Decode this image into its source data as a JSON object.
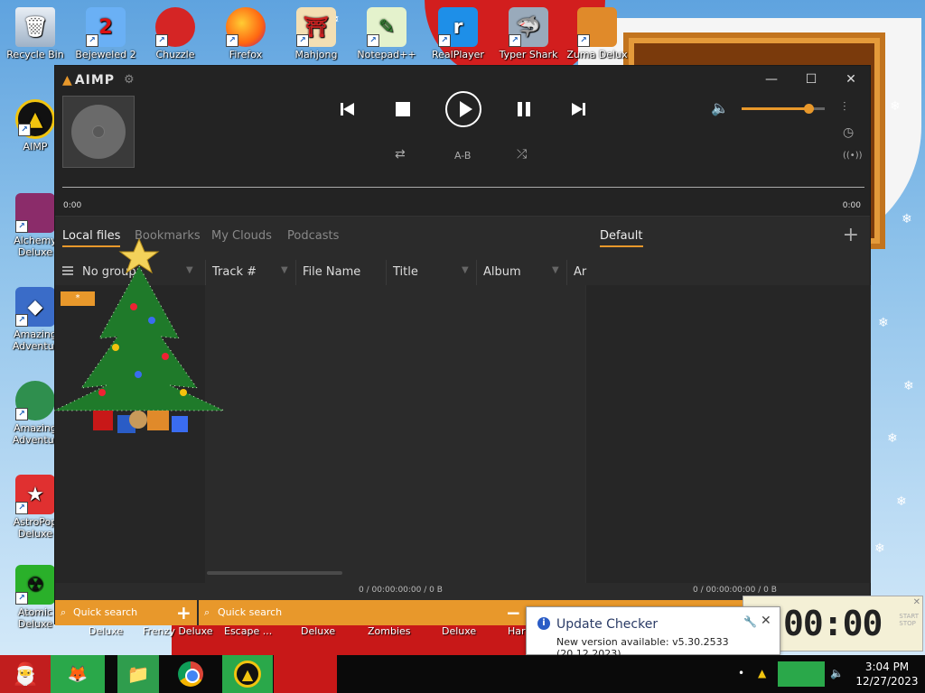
{
  "desktop": {
    "top_icons": [
      {
        "label": "Recycle Bin",
        "icon": "recycle-bin-icon"
      },
      {
        "label": "Bejeweled 2",
        "icon": "bejeweled-icon"
      },
      {
        "label": "Chuzzle",
        "icon": "chuzzle-icon"
      },
      {
        "label": "Firefox",
        "icon": "firefox-icon"
      },
      {
        "label": "Mahjong",
        "icon": "mahjong-icon"
      },
      {
        "label": "Notepad++",
        "icon": "notepadpp-icon"
      },
      {
        "label": "RealPlayer",
        "icon": "realplayer-icon"
      },
      {
        "label": "Typer Shark",
        "icon": "typer-shark-icon"
      },
      {
        "label": "Zuma Delux",
        "icon": "zuma-icon"
      }
    ],
    "left_icons": [
      {
        "label": "AIMP",
        "icon": "aimp-icon"
      },
      {
        "label": "Alchemy Deluxe",
        "icon": "alchemy-icon"
      },
      {
        "label": "Amazing Adventur",
        "icon": "amazing-adventures-icon"
      },
      {
        "label": "Amazing Adventur",
        "icon": "amazing-adventures-2-icon"
      },
      {
        "label": "AstroPop Deluxe",
        "icon": "astropop-icon"
      },
      {
        "label": "Atomic Deluxe",
        "icon": "atomica-icon"
      }
    ],
    "bottom_row_labels": [
      "Deluxe",
      "Frenzy Deluxe",
      "Escape ...",
      "Deluxe",
      "Zombies",
      "Deluxe",
      "Har"
    ]
  },
  "aimp": {
    "logo": "AIMP",
    "window_controls": {
      "minimize": "—",
      "maximize": "☐",
      "close": "✕"
    },
    "transport": {
      "prev": "previous-track",
      "stop": "stop",
      "play": "play",
      "pause": "pause",
      "next": "next-track"
    },
    "ab_label": "A-B",
    "volume_percent": 80,
    "time_elapsed": "0:00",
    "time_total": "0:00",
    "tabs": [
      "Local files",
      "Bookmarks",
      "My Clouds",
      "Podcasts"
    ],
    "active_tab": "Local files",
    "playlist_tab": "Default",
    "grouping": "No group",
    "columns": [
      "Track #",
      "File Name",
      "Title",
      "Album",
      "Ar"
    ],
    "star_chip": "*",
    "left_stats": "0 / 00:00:00:00 / 0 B",
    "right_stats": "0 / 00:00:00:00 / 0 B",
    "search_placeholder_left": "Quick search",
    "search_placeholder_right": "Quick search",
    "accent_color": "#e8982b"
  },
  "notification": {
    "title": "Update Checker",
    "message": "New version available: v5.30.2533 (20.12.2023)"
  },
  "clock_gadget": {
    "time": "00:00"
  },
  "taskbar": {
    "time": "3:04 PM",
    "date": "12/27/2023"
  }
}
